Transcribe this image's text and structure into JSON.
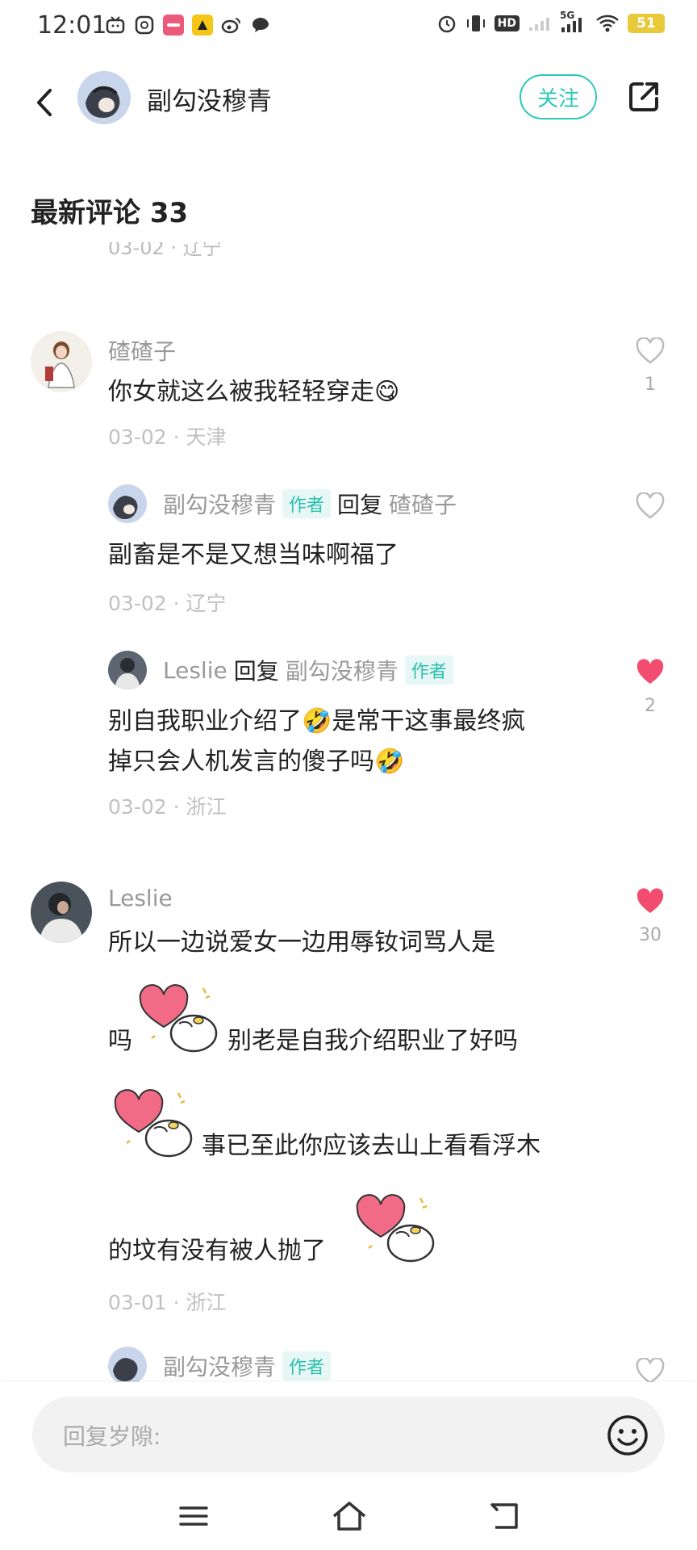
{
  "status_bar": {
    "time": "12:01",
    "battery": "51",
    "network": "5G",
    "hd": "HD"
  },
  "header": {
    "user_name": "副勾没穆青",
    "follow_label": "关注"
  },
  "section": {
    "title": "最新评论 33"
  },
  "cut_off_meta": "03-02 · 辽宁",
  "comments": [
    {
      "user": "碴碴子",
      "text": "你女就这么被我轻轻穿走😋",
      "meta": "03-02 · 天津",
      "likes": "1",
      "liked": false,
      "replies": [
        {
          "user": "副勾没穆青",
          "user_tag": "作者",
          "reply_word": "回复",
          "target": "碴碴子",
          "target_tag": "",
          "text": "副畜是不是又想当味啊福了",
          "meta": "03-02 · 辽宁",
          "likes": "",
          "liked": false
        },
        {
          "user": "Leslie",
          "user_tag": "",
          "reply_word": "回复",
          "target": "副勾没穆青",
          "target_tag": "作者",
          "text_lines": [
            "别自我职业介绍了🤣是常干这事最终疯",
            "掉只会人机发言的傻子吗🤣"
          ],
          "meta": "03-02 · 浙江",
          "likes": "2",
          "liked": true
        }
      ]
    },
    {
      "user": "Leslie",
      "text_lines": [
        "所以一边说爱女一边用辱钕词骂人是",
        "吗",
        "别老是自我介绍职业了好吗",
        "事已至此你应该去山上看看浮木",
        "的坟有没有被人抛了"
      ],
      "meta": "03-01 · 浙江",
      "likes": "30",
      "liked": true,
      "replies": [
        {
          "user": "副勾没穆青",
          "user_tag": "作者"
        }
      ]
    }
  ],
  "input": {
    "placeholder": "回复岁隙:"
  },
  "colors": {
    "accent": "#2cc8b8",
    "like_red": "#f24d6e",
    "tag_bg": "#e6f7f5"
  }
}
